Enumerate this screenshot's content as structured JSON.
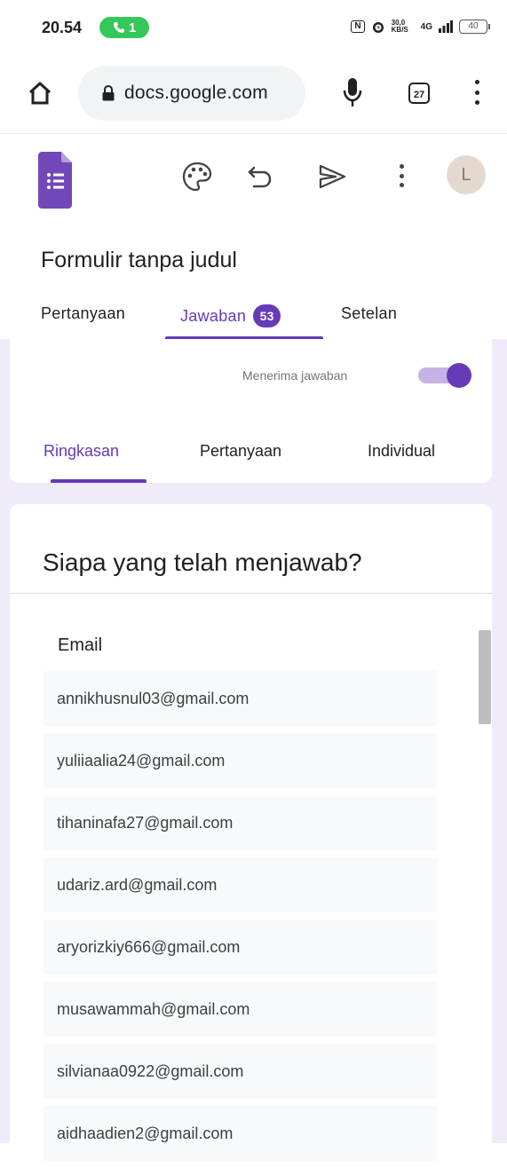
{
  "status_bar": {
    "time": "20.54",
    "call_count": "1",
    "nfc": "N",
    "data_speed": "30,0 KB/S",
    "network": "4G",
    "battery": "40"
  },
  "browser": {
    "url": "docs.google.com",
    "tab_count": "27",
    "icons": [
      "home-icon",
      "lock-icon",
      "mic-icon",
      "tabs-icon",
      "more-vert-icon"
    ]
  },
  "forms_header": {
    "form_title": "Formulir tanpa judul",
    "avatar_initial": "L",
    "icons": [
      "forms-logo-icon",
      "palette-icon",
      "undo-icon",
      "send-icon",
      "more-vert-icon"
    ],
    "tabs": [
      {
        "label": "Pertanyaan"
      },
      {
        "label": "Jawaban",
        "badge": "53"
      },
      {
        "label": "Setelan"
      }
    ]
  },
  "responses": {
    "accepting_label": "Menerima jawaban",
    "accepting": true,
    "sub_tabs": [
      {
        "label": "Ringkasan"
      },
      {
        "label": "Pertanyaan"
      },
      {
        "label": "Individual"
      }
    ],
    "who_responded_title": "Siapa yang telah menjawab?",
    "column_header": "Email",
    "emails": [
      "annikhusnul03@gmail.com",
      "yuliiaalia24@gmail.com",
      "tihaninafa27@gmail.com",
      "udariz.ard@gmail.com",
      "aryorizkiy666@gmail.com",
      "musawammah@gmail.com",
      "silvianaa0922@gmail.com",
      "aidhaadien2@gmail.com"
    ]
  },
  "colors": {
    "accent": "#673ab7",
    "background": "#f0ebf8",
    "call_pill": "#34c759"
  }
}
